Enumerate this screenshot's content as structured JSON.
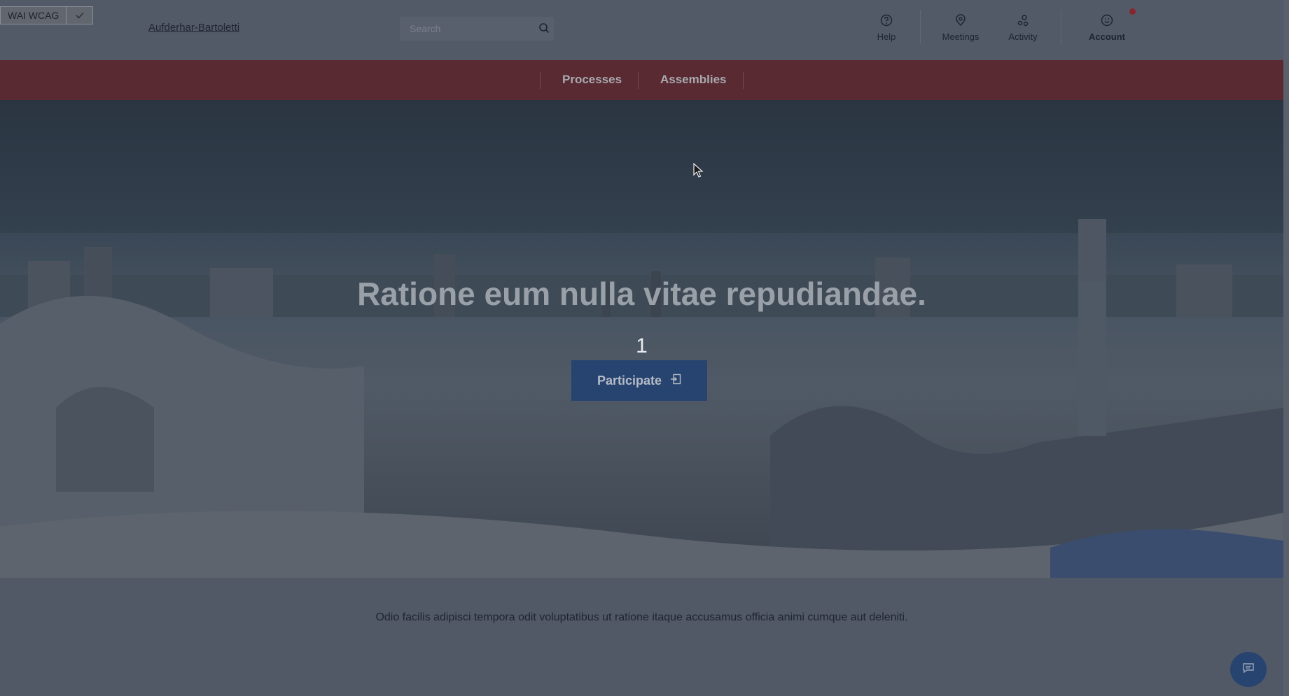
{
  "accessibility": {
    "label": "WAI WCAG"
  },
  "header": {
    "org_name": "Aufderhar-Bartoletti",
    "search_placeholder": "Search",
    "nav": {
      "help": "Help",
      "meetings": "Meetings",
      "activity": "Activity",
      "account": "Account"
    }
  },
  "menu": {
    "items": [
      "Processes",
      "Assemblies"
    ]
  },
  "hero": {
    "title": "Ratione eum nulla vitae repudiandae.",
    "count": "1",
    "participate_label": "Participate"
  },
  "description": "Odio facilis adipisci tempora odit voluptatibus ut ratione itaque accusamus officia animi cumque aut deleniti.",
  "colors": {
    "menubar": "#5a2a32",
    "primary_button": "#27436f",
    "notification": "#8a2530"
  }
}
